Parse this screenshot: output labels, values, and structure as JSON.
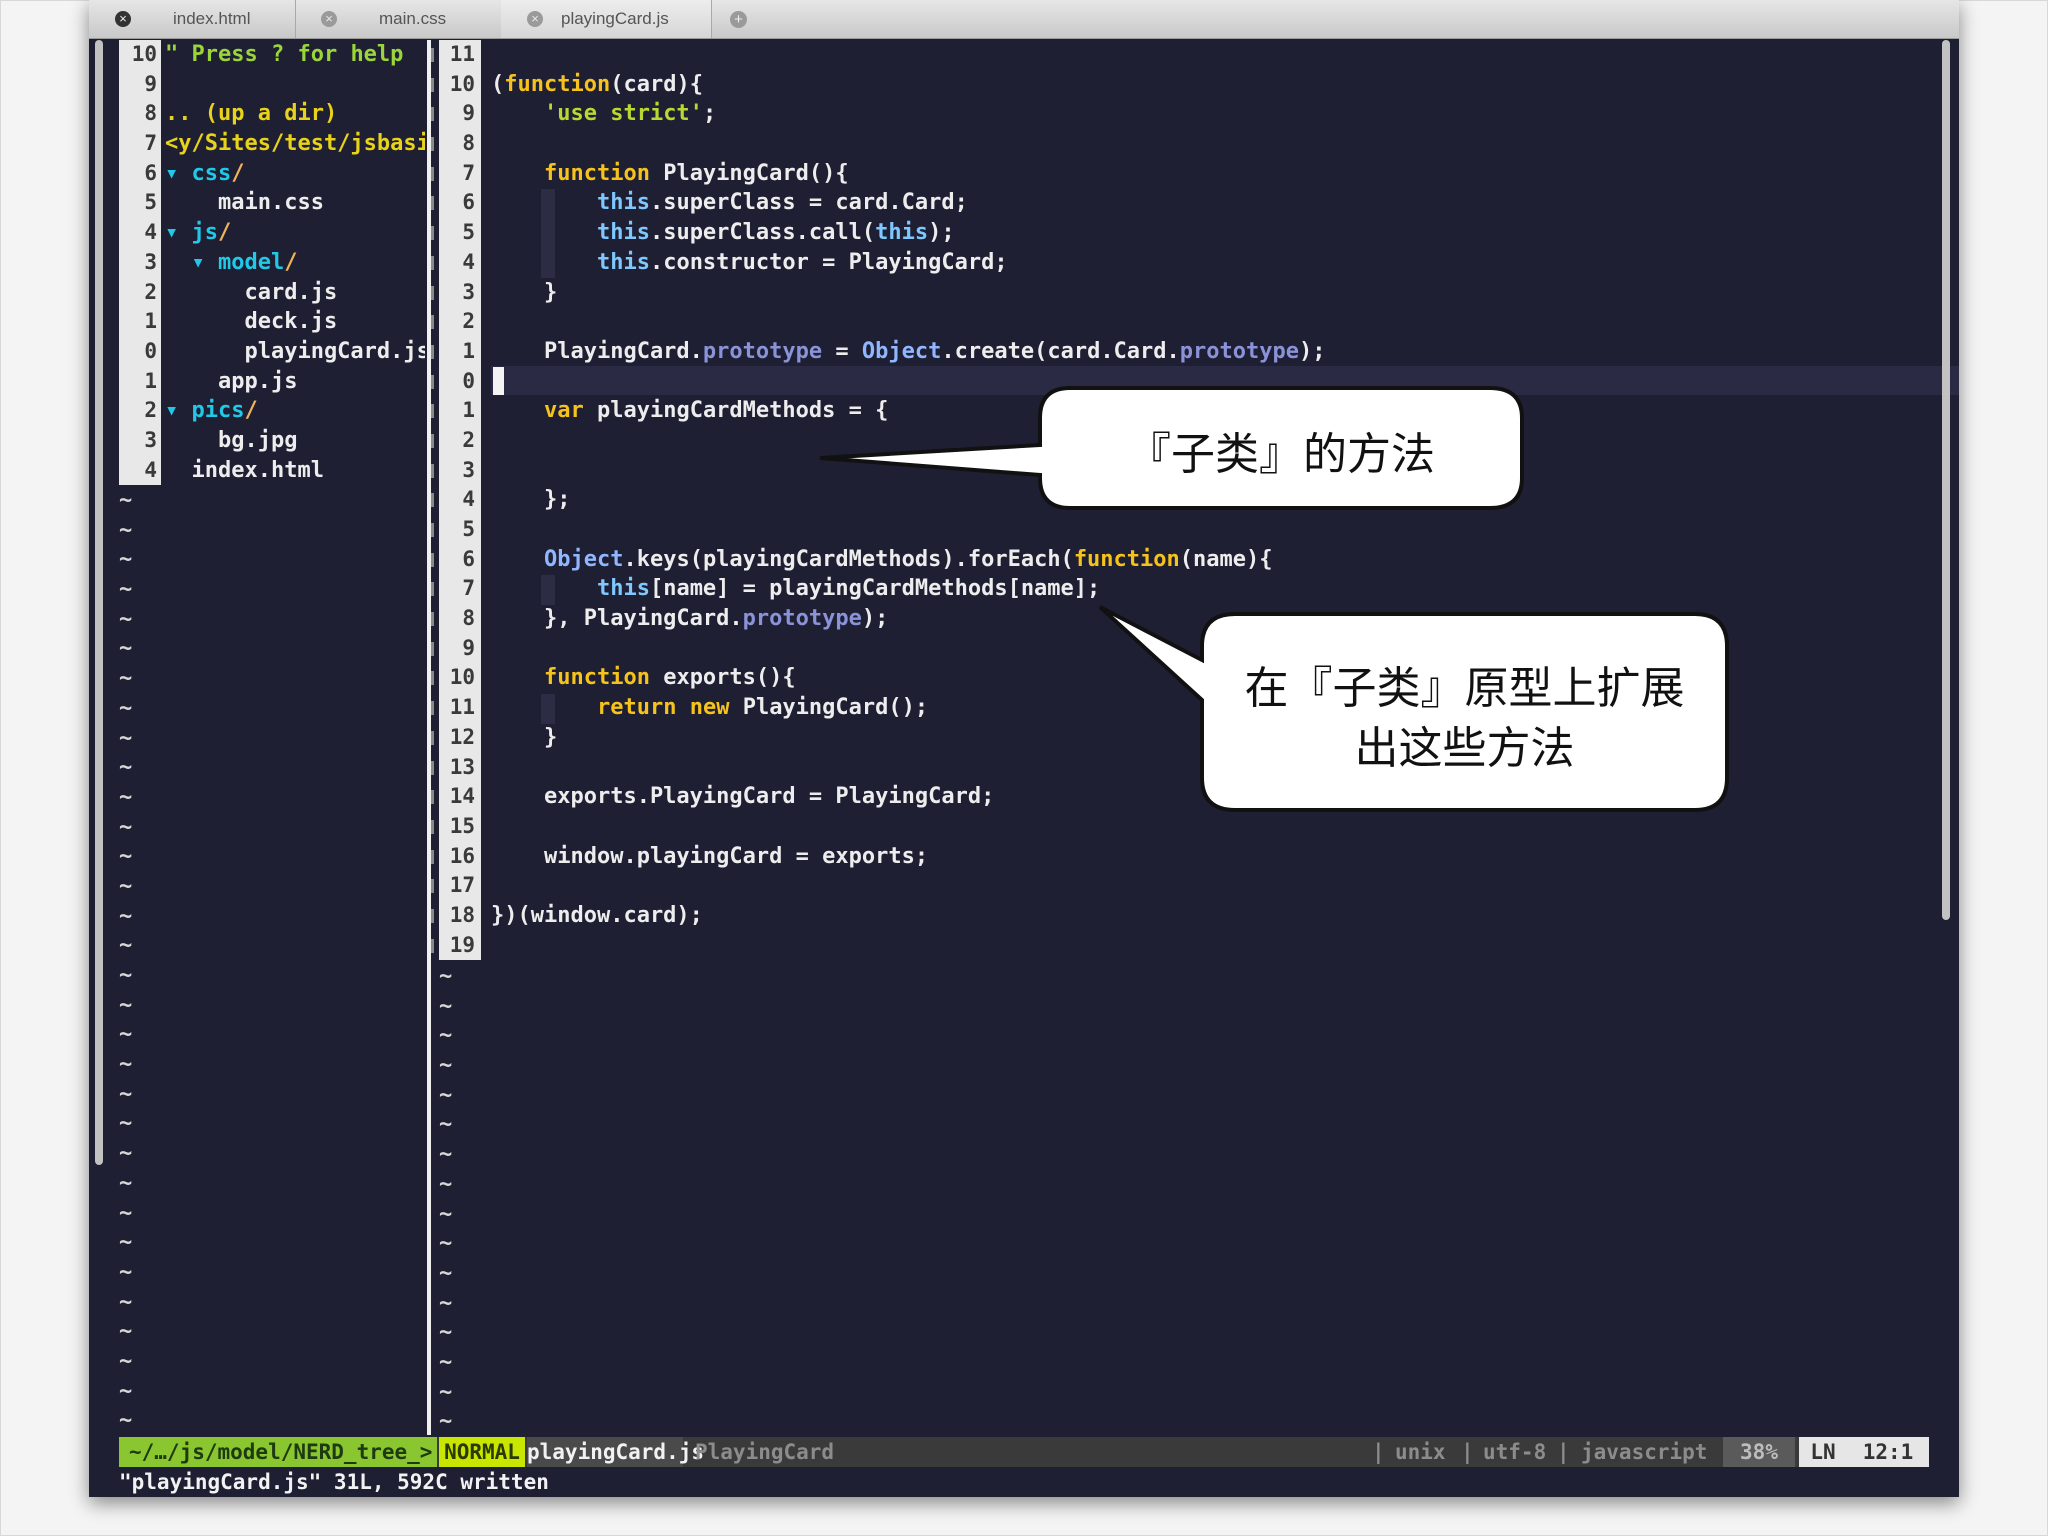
{
  "tabs": [
    {
      "label": "index.html",
      "active": true
    },
    {
      "label": "main.css",
      "active": false
    },
    {
      "label": "playingCard.js",
      "active": false
    }
  ],
  "tree": {
    "gutter": [
      "10",
      "9",
      "8",
      "7",
      "6",
      "5",
      "4",
      "3",
      "2",
      "1",
      "0",
      "1",
      "2",
      "3",
      "4"
    ],
    "lines": [
      [
        {
          "t": "\" ",
          "c": "c-green"
        },
        {
          "t": "Press ? for help",
          "c": "c-green"
        }
      ],
      [],
      [
        {
          "t": ".. (up a dir)",
          "c": "c-yellow"
        }
      ],
      [
        {
          "t": "<y/Sites/test/jsbasic",
          "c": "c-yellow"
        }
      ],
      [
        {
          "t": "▾ ",
          "c": "c-cyan"
        },
        {
          "t": "css",
          "c": "c-cyan"
        },
        {
          "t": "/",
          "c": "c-orange"
        }
      ],
      [
        {
          "t": "    main.css",
          "c": "c-white"
        }
      ],
      [
        {
          "t": "▾ ",
          "c": "c-cyan"
        },
        {
          "t": "js",
          "c": "c-cyan"
        },
        {
          "t": "/",
          "c": "c-orange"
        }
      ],
      [
        {
          "t": "  ▾ ",
          "c": "c-cyan"
        },
        {
          "t": "model",
          "c": "c-cyan"
        },
        {
          "t": "/",
          "c": "c-orange"
        }
      ],
      [
        {
          "t": "      card.js",
          "c": "c-white"
        }
      ],
      [
        {
          "t": "      deck.js",
          "c": "c-white"
        }
      ],
      [
        {
          "t": "      playingCard.js",
          "c": "c-white"
        }
      ],
      [
        {
          "t": "    app.js",
          "c": "c-white"
        }
      ],
      [
        {
          "t": "▾ ",
          "c": "c-cyan"
        },
        {
          "t": "pics",
          "c": "c-cyan"
        },
        {
          "t": "/",
          "c": "c-orange"
        }
      ],
      [
        {
          "t": "    bg.jpg",
          "c": "c-white"
        }
      ],
      [
        {
          "t": "  index.html",
          "c": "c-white"
        }
      ]
    ],
    "tilde": "~"
  },
  "code": {
    "gutter": [
      "11",
      "10",
      "9",
      "8",
      "7",
      "6",
      "5",
      "4",
      "3",
      "2",
      "1",
      "0",
      "1",
      "2",
      "3",
      "4",
      "5",
      "6",
      "7",
      "8",
      "9",
      "10",
      "11",
      "12",
      "13",
      "14",
      "15",
      "16",
      "17",
      "18",
      "19"
    ],
    "lines": [
      [],
      [
        {
          "t": "(",
          "c": "c-white"
        },
        {
          "t": "function",
          "c": "c-kw"
        },
        {
          "t": "(card){",
          "c": "c-white"
        }
      ],
      [
        {
          "t": "    ",
          "c": "c-white"
        },
        {
          "t": "'use strict'",
          "c": "c-str"
        },
        {
          "t": ";",
          "c": "c-white"
        }
      ],
      [],
      [
        {
          "t": "    ",
          "c": "c-white"
        },
        {
          "t": "function",
          "c": "c-kw"
        },
        {
          "t": " PlayingCard(){",
          "c": "c-white"
        }
      ],
      [
        {
          "t": "        ",
          "c": "c-white"
        },
        {
          "t": "this",
          "c": "c-this"
        },
        {
          "t": ".superClass = card.Card;",
          "c": "c-white"
        }
      ],
      [
        {
          "t": "        ",
          "c": "c-white"
        },
        {
          "t": "this",
          "c": "c-this"
        },
        {
          "t": ".superClass.call(",
          "c": "c-white"
        },
        {
          "t": "this",
          "c": "c-this"
        },
        {
          "t": ");",
          "c": "c-white"
        }
      ],
      [
        {
          "t": "        ",
          "c": "c-white"
        },
        {
          "t": "this",
          "c": "c-this"
        },
        {
          "t": ".constructor = PlayingCard;",
          "c": "c-white"
        }
      ],
      [
        {
          "t": "    }",
          "c": "c-white"
        }
      ],
      [],
      [
        {
          "t": "    PlayingCard.",
          "c": "c-white"
        },
        {
          "t": "prototype",
          "c": "c-proto"
        },
        {
          "t": " = ",
          "c": "c-white"
        },
        {
          "t": "Object",
          "c": "c-obj"
        },
        {
          "t": ".create(card.Card.",
          "c": "c-white"
        },
        {
          "t": "prototype",
          "c": "c-proto"
        },
        {
          "t": ");",
          "c": "c-white"
        }
      ],
      [],
      [
        {
          "t": "    ",
          "c": "c-white"
        },
        {
          "t": "var",
          "c": "c-kw"
        },
        {
          "t": " playingCardMethods = {",
          "c": "c-white"
        }
      ],
      [],
      [],
      [
        {
          "t": "    };",
          "c": "c-white"
        }
      ],
      [],
      [
        {
          "t": "    ",
          "c": "c-white"
        },
        {
          "t": "Object",
          "c": "c-obj"
        },
        {
          "t": ".keys(playingCardMethods).forEach(",
          "c": "c-white"
        },
        {
          "t": "function",
          "c": "c-kw"
        },
        {
          "t": "(name){",
          "c": "c-white"
        }
      ],
      [
        {
          "t": "        ",
          "c": "c-white"
        },
        {
          "t": "this",
          "c": "c-this"
        },
        {
          "t": "[name] = playingCardMethods[name];",
          "c": "c-white"
        }
      ],
      [
        {
          "t": "    }, PlayingCard.",
          "c": "c-white"
        },
        {
          "t": "prototype",
          "c": "c-proto"
        },
        {
          "t": ");",
          "c": "c-white"
        }
      ],
      [],
      [
        {
          "t": "    ",
          "c": "c-white"
        },
        {
          "t": "function",
          "c": "c-kw"
        },
        {
          "t": " exports(){",
          "c": "c-white"
        }
      ],
      [
        {
          "t": "        ",
          "c": "c-white"
        },
        {
          "t": "return",
          "c": "c-kw"
        },
        {
          "t": " ",
          "c": "c-white"
        },
        {
          "t": "new",
          "c": "c-kw"
        },
        {
          "t": " PlayingCard();",
          "c": "c-white"
        }
      ],
      [
        {
          "t": "    }",
          "c": "c-white"
        }
      ],
      [],
      [
        {
          "t": "    exports.PlayingCard = PlayingCard;",
          "c": "c-white"
        }
      ],
      [],
      [
        {
          "t": "    window.playingCard = exports;",
          "c": "c-white"
        }
      ],
      [],
      [
        {
          "t": "})(window.card);",
          "c": "c-white"
        }
      ],
      []
    ]
  },
  "status": {
    "nerdtree": "~/…/js/model/NERD_tree_>",
    "mode": "NORMAL",
    "filename": "playingCard.js",
    "func": "PlayingCard",
    "sep1": "|",
    "fileformat": "unix",
    "sep2": "|",
    "encoding": "utf-8",
    "sep3": "|",
    "filetype": "javascript",
    "percent": "38%",
    "ln_label": "LN",
    "position": "12:1"
  },
  "cmdline": "\"playingCard.js\" 31L, 592C written",
  "callouts": {
    "first": "『子类』的方法",
    "second_line1": "在『子类』原型上扩展",
    "second_line2": "出这些方法"
  },
  "colors": {
    "editor_bg": "#1f1f33",
    "keyword": "#f5c31c",
    "string": "#b8d832",
    "this": "#7fc8ff",
    "mode_bg": "#c8e600",
    "nerdtree_bg": "#8ac62f"
  }
}
